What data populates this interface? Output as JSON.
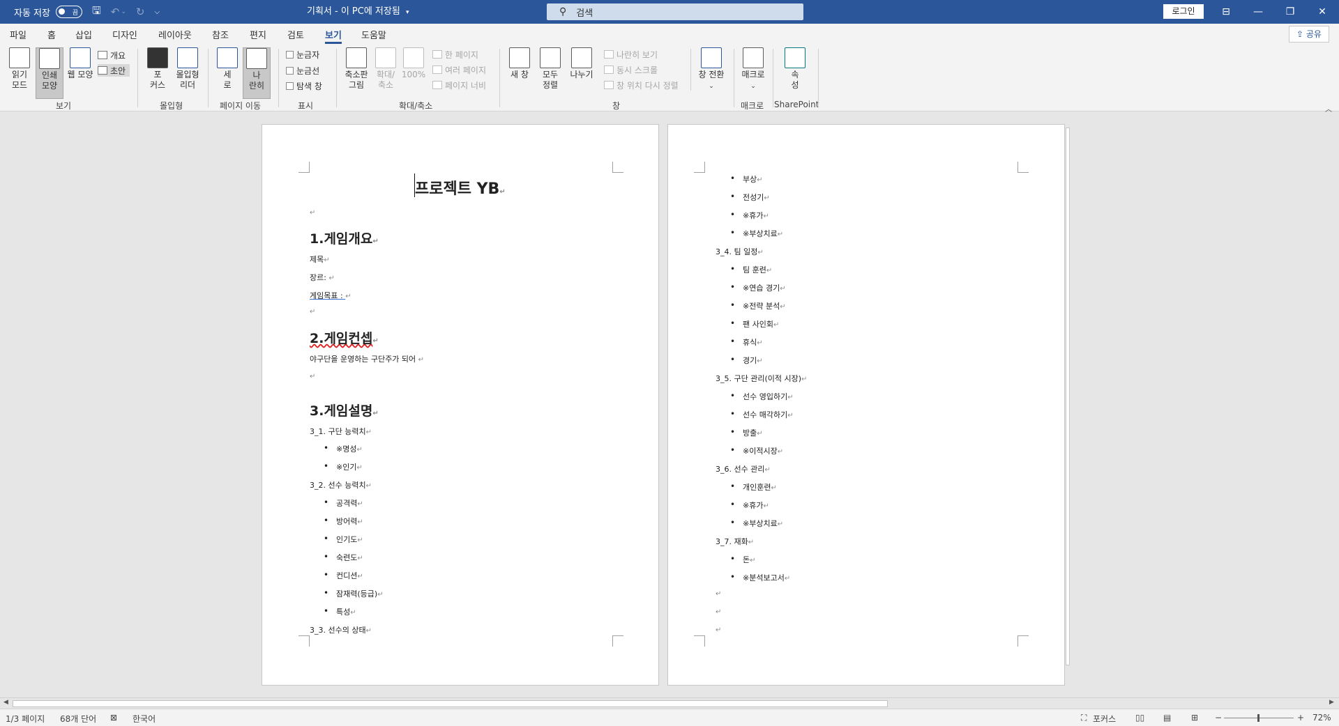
{
  "titlebar": {
    "autosave_label": "자동 저장",
    "autosave_state": "끔",
    "document_title": "기획서 - 이 PC에 저장됨",
    "search_placeholder": "검색",
    "login_label": "로그인"
  },
  "tabs": [
    "파일",
    "홈",
    "삽입",
    "디자인",
    "레이아웃",
    "참조",
    "편지",
    "검토",
    "보기",
    "도움말"
  ],
  "active_tab": "보기",
  "share_label": "공유",
  "ribbon": {
    "views": {
      "group": "보기",
      "read_mode": [
        "읽기",
        "모드"
      ],
      "print_layout": [
        "인쇄",
        "모양"
      ],
      "web_layout": "웹 모양",
      "outline": "개요",
      "draft": "초안"
    },
    "immersive": {
      "group": "몰입형",
      "focus": [
        "포",
        "커스"
      ],
      "immersive_reader": [
        "몰입형",
        "리더"
      ]
    },
    "page_movement": {
      "group": "페이지 이동",
      "vertical": [
        "세",
        "로"
      ],
      "side_by_side": [
        "나",
        "란히"
      ]
    },
    "show": {
      "group": "표시",
      "ruler": "눈금자",
      "gridlines": "눈금선",
      "navigation_pane": "탐색 창"
    },
    "zoom": {
      "group": "확대/축소",
      "zoom_picture": [
        "축소판",
        "그림"
      ],
      "zoom": [
        "확대/",
        "축소"
      ],
      "zoom_100": "100%",
      "one_page": "한 페이지",
      "multiple_pages": "여러 페이지",
      "page_width": "페이지 너비"
    },
    "window": {
      "group": "창",
      "new_window": "새 창",
      "arrange_all": [
        "모두",
        "정렬"
      ],
      "split": "나누기",
      "view_side_by_side": "나란히 보기",
      "synchronous_scrolling": "동시 스크롤",
      "reset_window_position": "창 위치 다시 정렬",
      "switch_windows": "창 전환"
    },
    "macros": {
      "group": "매크로",
      "macros": "매크로"
    },
    "sharepoint": {
      "group": "SharePoint",
      "properties": [
        "속",
        "성"
      ]
    }
  },
  "document": {
    "page1": {
      "title": "프로젝트 YB",
      "s1_heading": "1.게임개요",
      "s1_lines": [
        "제목",
        "장르: ",
        "게임목표 : "
      ],
      "s2_heading": "2.게임컨셉",
      "s2_text": "야구단을 운영하는 구단주가 되어 ",
      "s3_heading": "3.게임설명",
      "s3_1": "3_1. 구단 능력치",
      "s3_1_items": [
        "※명성",
        "※인기"
      ],
      "s3_2": "3_2. 선수 능력치",
      "s3_2_items": [
        "공격력",
        "방어력",
        "인기도",
        "숙련도",
        "컨디션",
        "잠재력(등급)",
        "특성"
      ],
      "s3_3": "3_3. 선수의 상태"
    },
    "page2": {
      "top_items": [
        "부상",
        "전성기",
        "※휴가",
        "※부상치료"
      ],
      "s3_4": "3_4. 팀 일정",
      "s3_4_items": [
        "팀 훈련",
        "※연습 경기",
        "※전략 분석",
        "팬 사인회",
        "휴식",
        "경기"
      ],
      "s3_5": "3_5. 구단 관리(이적 시장)",
      "s3_5_items": [
        "선수 영입하기",
        "선수 매각하기",
        "방출",
        "※이적시장"
      ],
      "s3_6": "3_6. 선수 관리",
      "s3_6_items": [
        "개인훈련",
        "※휴가",
        "※부상치료"
      ],
      "s3_7": "3_7. 재화",
      "s3_7_items": [
        "돈",
        "※분석보고서"
      ]
    }
  },
  "statusbar": {
    "page": "1/3 페이지",
    "words": "68개 단어",
    "language": "한국어",
    "focus": "포커스",
    "zoom": "72%"
  },
  "colors": {
    "titlebar": "#2b579a",
    "accent": "#2b579a"
  }
}
